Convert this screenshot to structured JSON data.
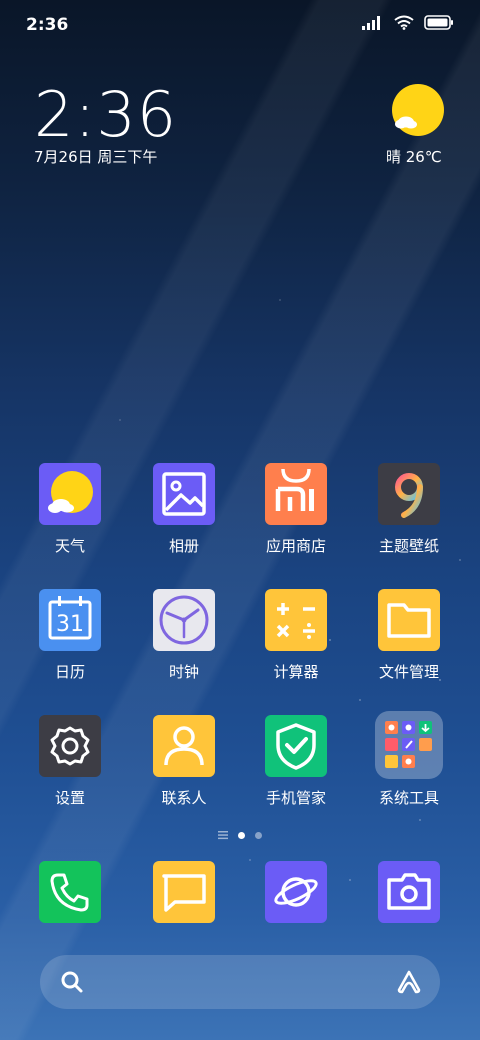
{
  "status_bar": {
    "time": "2:36"
  },
  "clock_widget": {
    "time": "2:36",
    "date": "7月26日 周三下午"
  },
  "weather_widget": {
    "text": "晴 26℃"
  },
  "apps": [
    {
      "label": "天气",
      "icon": "weather-icon"
    },
    {
      "label": "相册",
      "icon": "gallery-icon"
    },
    {
      "label": "应用商店",
      "icon": "app-store-icon"
    },
    {
      "label": "主题壁纸",
      "icon": "themes-icon"
    },
    {
      "label": "日历",
      "icon": "calendar-icon",
      "day": "31"
    },
    {
      "label": "时钟",
      "icon": "clock-icon"
    },
    {
      "label": "计算器",
      "icon": "calculator-icon"
    },
    {
      "label": "文件管理",
      "icon": "file-manager-icon"
    },
    {
      "label": "设置",
      "icon": "settings-icon"
    },
    {
      "label": "联系人",
      "icon": "contacts-icon"
    },
    {
      "label": "手机管家",
      "icon": "security-icon"
    },
    {
      "label": "系统工具",
      "icon": "folder-icon"
    }
  ],
  "dock": [
    {
      "icon": "phone-icon"
    },
    {
      "icon": "messages-icon"
    },
    {
      "icon": "browser-icon"
    },
    {
      "icon": "camera-icon"
    }
  ],
  "colors": {
    "weather": "#6b5cf6",
    "gallery": "#6b5cf6",
    "appstore": "#ff7f4d",
    "themes": "#3d3d45",
    "calendar": "#4a90f0",
    "clock": "#e8e8ee",
    "calculator": "#ffc53a",
    "files": "#ffc53a",
    "settings": "#3d3d45",
    "contacts": "#ffc53a",
    "security": "#10c27a",
    "phone": "#13c35b",
    "messages": "#ffc53a",
    "browser": "#6b5cf6",
    "camera": "#6b5cf6"
  }
}
